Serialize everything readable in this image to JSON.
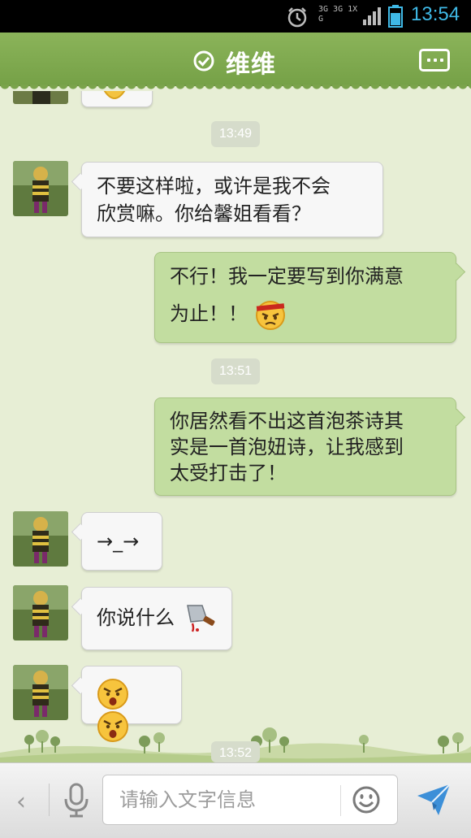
{
  "status_bar": {
    "time": "13:54",
    "net_top": "3G 3G 1X",
    "net_g": "G",
    "accent_color": "#3fb9e6"
  },
  "header": {
    "title": "维维",
    "verified_icon": "check-circle-icon",
    "menu_icon": "more-dots-icon",
    "bg_color": "#7aa34b"
  },
  "messages": [
    {
      "type": "time",
      "text": "13:49"
    },
    {
      "type": "in",
      "text_line1": "不要这样啦，或许是我不会",
      "text_line2": "欣赏嘛。你给馨姐看看？"
    },
    {
      "type": "out",
      "text_line1": "不行！我一定要写到你满意",
      "text_line2": "为止！！",
      "emoji": "pouting-emoji"
    },
    {
      "type": "time",
      "text": "13:51"
    },
    {
      "type": "out",
      "text_line1": "你居然看不出这首泡茶诗其",
      "text_line2": "实是一首泡妞诗，让我感到",
      "text_line3": "太受打击了！"
    },
    {
      "type": "in",
      "text": "→_→"
    },
    {
      "type": "in",
      "text": "你说什么",
      "emoji": "cleaver-emoji"
    },
    {
      "type": "in",
      "emoji": "angry-face-emoji x2"
    },
    {
      "type": "time",
      "text": "13:52"
    }
  ],
  "input_bar": {
    "placeholder": "请输入文字信息",
    "back_icon": "chevron-left-icon",
    "mic_icon": "microphone-icon",
    "emoji_icon": "smiley-icon",
    "send_icon": "send-arrow-icon"
  }
}
